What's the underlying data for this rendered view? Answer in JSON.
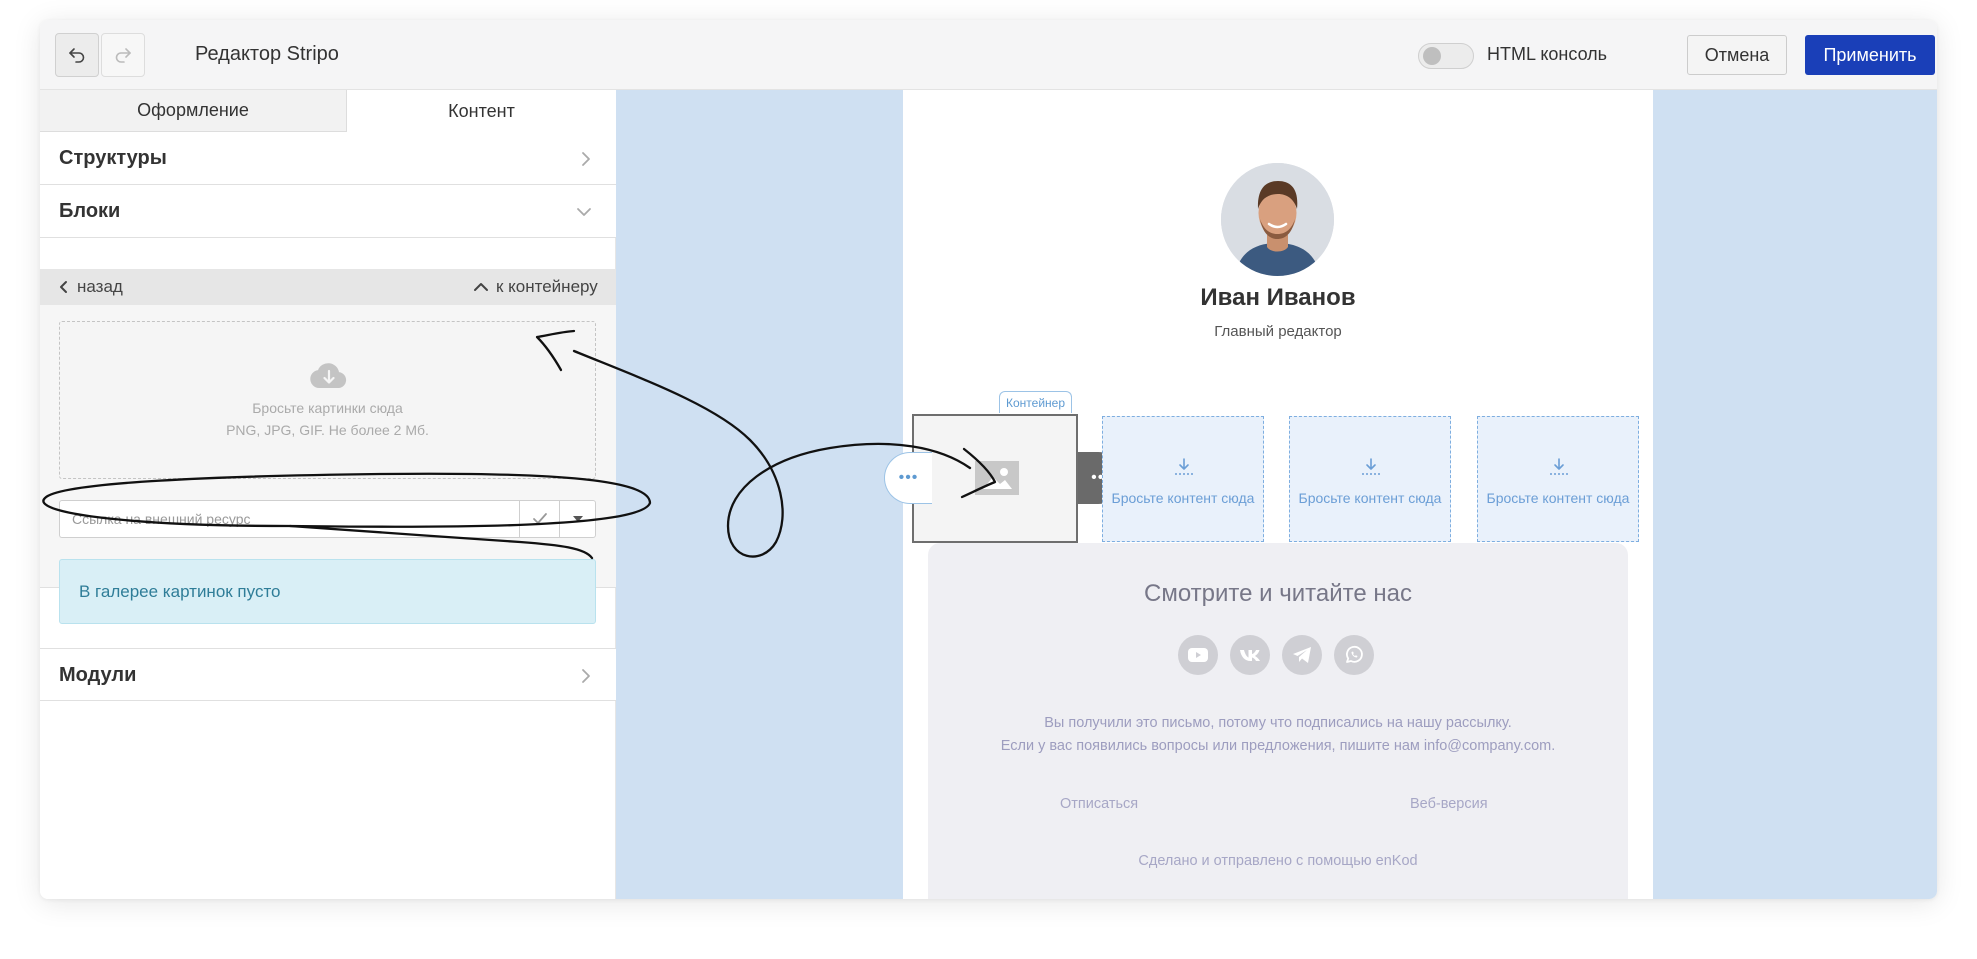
{
  "header": {
    "title": "Редактор Stripo",
    "html_console_label": "HTML консоль",
    "cancel_label": "Отмена",
    "apply_label": "Применить"
  },
  "sidebar": {
    "tabs": [
      {
        "label": "Оформление",
        "active": false
      },
      {
        "label": "Контент",
        "active": true
      }
    ],
    "sections": {
      "structures": "Структуры",
      "blocks": "Блоки",
      "modules": "Модули"
    },
    "nav": {
      "back": "назад",
      "to_container": "к контейнеру"
    },
    "upload": {
      "line1": "Бросьте картинки сюда",
      "line2": "PNG, JPG, GIF. Не более 2 Мб."
    },
    "url_placeholder": "Ссылка на внешний ресурс",
    "gallery_empty": "В галерее картинок пусто"
  },
  "email": {
    "name": "Иван Иванов",
    "role": "Главный редактор",
    "container_tag": "Контейнер",
    "drop_hint": "Бросьте контент сюда",
    "footer": {
      "title": "Смотрите и читайте нас",
      "social_icons": [
        "youtube-icon",
        "vk-icon",
        "telegram-icon",
        "whatsapp-icon"
      ],
      "note_line1": "Вы получили это письмо, потому что подписались на нашу рассылку.",
      "note_line2": "Если у вас появились вопросы или предложения, пишите нам info@company.com.",
      "unsubscribe": "Отписаться",
      "web_version": "Веб-версия",
      "made_with": "Сделано и отправлено с помощью enKod"
    }
  },
  "colors": {
    "primary": "#1a3fb8",
    "canvas_bg": "#cfe0f2",
    "drop_blue": "#6b9ed6",
    "info_bg": "#d9eff6"
  }
}
